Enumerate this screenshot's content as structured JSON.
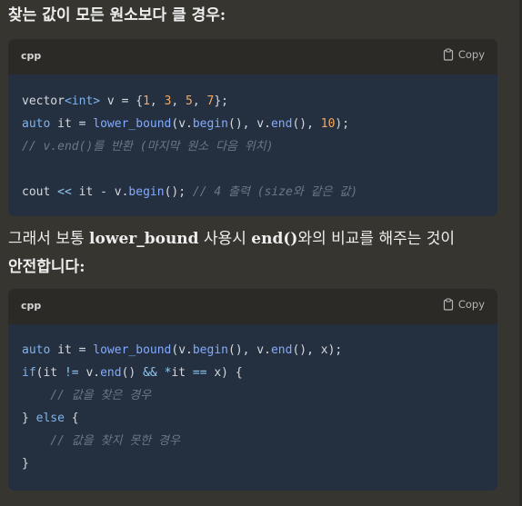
{
  "prose": {
    "p1": "찾는 값이 모든 원소보다 클 경우:",
    "p2_a": "그래서 보통 ",
    "p2_b": "lower_bound",
    "p2_c": " 사용시 ",
    "p2_d": "end()",
    "p2_e": "와의 비교를 해주는 것이",
    "p2_f": "안전합니다:"
  },
  "code_blocks": [
    {
      "lang": "cpp",
      "copy_label": "Copy",
      "copy_icon": "clipboard-icon",
      "lines": {
        "l1": {
          "a": "vector",
          "b": "<int>",
          "c": " v = {",
          "d": "1",
          "e": ", ",
          "f": "3",
          "g": ", ",
          "h": "5",
          "i": ", ",
          "j": "7",
          "k": "};"
        },
        "l2": {
          "a": "auto",
          "b": " it = ",
          "c": "lower_bound",
          "d": "(v.",
          "e": "begin",
          "f": "(), v.",
          "g": "end",
          "h": "(), ",
          "i": "10",
          "j": ");"
        },
        "l3": "// v.end()를 반환 (마지막 원소 다음 위치)",
        "l4": "",
        "l5": {
          "a": "cout ",
          "b": "<<",
          "c": " it - v.",
          "d": "begin",
          "e": "(); ",
          "f": "// 4 출력 (size와 같은 값)"
        }
      }
    },
    {
      "lang": "cpp",
      "copy_label": "Copy",
      "copy_icon": "clipboard-icon",
      "lines": {
        "l1": {
          "a": "auto",
          "b": " it = ",
          "c": "lower_bound",
          "d": "(v.",
          "e": "begin",
          "f": "(), v.",
          "g": "end",
          "h": "(), x);"
        },
        "l2": {
          "a": "if",
          "b": "(it ",
          "c": "!=",
          "d": " v.",
          "e": "end",
          "f": "() ",
          "g": "&&",
          "h": " ",
          "i": "*",
          "j": "it ",
          "k": "==",
          "l": " x) {"
        },
        "l3": "    // 값을 찾은 경우",
        "l4": {
          "a": "} ",
          "b": "else",
          "c": " {"
        },
        "l5": "    // 값을 찾지 못한 경우",
        "l6": "}"
      }
    }
  ],
  "colors": {
    "page_bg": "#37352f",
    "code_bg": "#243040",
    "header_bg": "#2b2a26",
    "keyword": "#7fb3ee",
    "function": "#82aaff",
    "number": "#f5a860",
    "comment": "#6b7687"
  }
}
